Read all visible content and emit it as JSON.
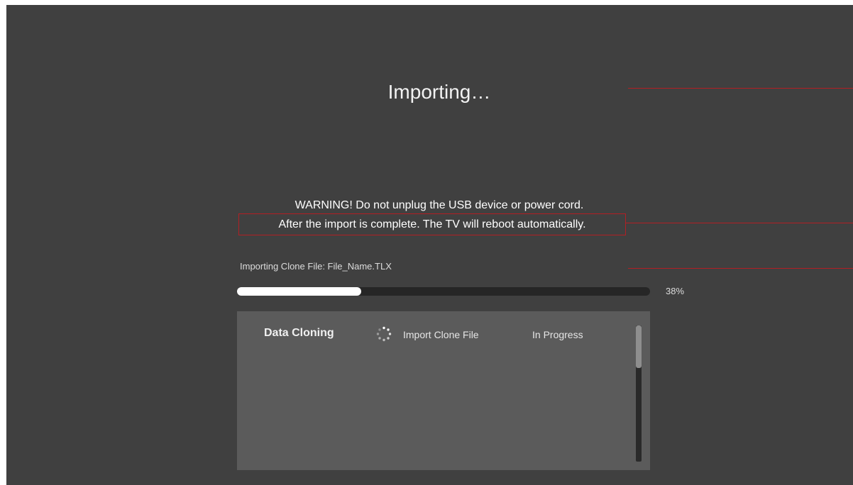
{
  "title": "Importing…",
  "warning": {
    "line1": "WARNING! Do not unplug the USB device or power cord.",
    "line2": "After the import is complete. The TV will reboot automatically."
  },
  "file": {
    "label": "Importing Clone File: File_Name.TLX"
  },
  "progress": {
    "value": 0.3,
    "label": "38%"
  },
  "tasks": {
    "category": "Data Cloning",
    "items": [
      {
        "icon": "loading-spinner-icon",
        "name": "Import Clone File",
        "status": "In Progress"
      }
    ]
  },
  "colors": {
    "background": "#404040",
    "panel": "#5b5b5b",
    "annotation_red": "#b21f24",
    "progress_fill": "#ffffff",
    "progress_track": "#262626"
  }
}
